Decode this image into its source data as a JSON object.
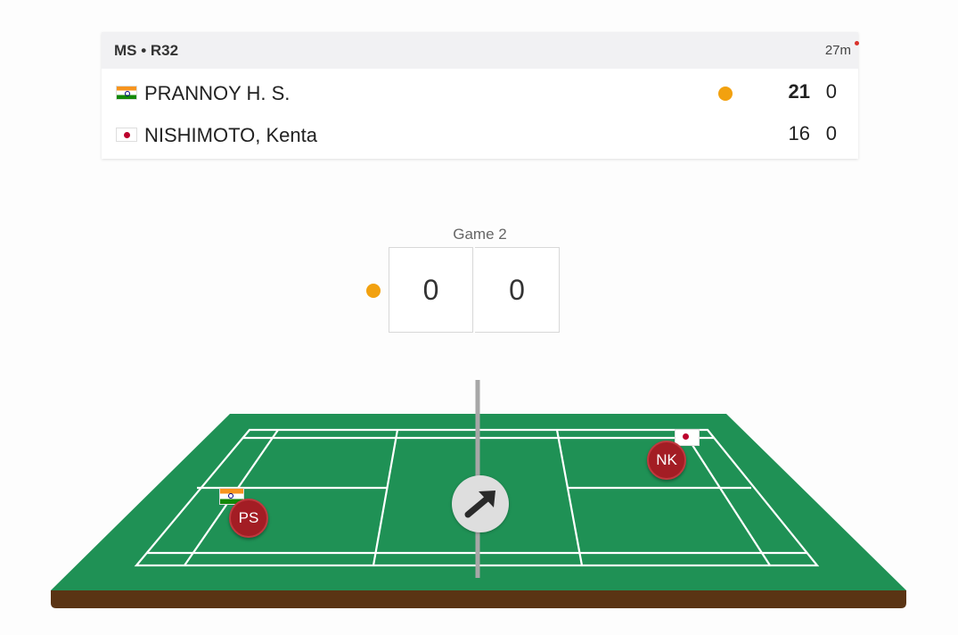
{
  "match": {
    "round": "MS • R32",
    "elapsed": "27m"
  },
  "players": [
    {
      "name": "PRANNOY H. S.",
      "country_flag": "india-flag-icon",
      "game1": "21",
      "game2": "0",
      "serving": true
    },
    {
      "name": "NISHIMOTO, Kenta",
      "country_flag": "japan-flag-icon",
      "game1": "16",
      "game2": "0",
      "serving": false
    }
  ],
  "current_game": {
    "label": "Game 2",
    "left_score": "0",
    "right_score": "0"
  },
  "court": {
    "left_player_initials": "PS",
    "right_player_initials": "NK",
    "shuttle_icon": "arrow-up-right-icon"
  },
  "colors": {
    "serve_indicator": "#f2a10f",
    "court_green": "#1f9155",
    "player_badge": "#a31d24",
    "live_dot": "#d9322b"
  }
}
